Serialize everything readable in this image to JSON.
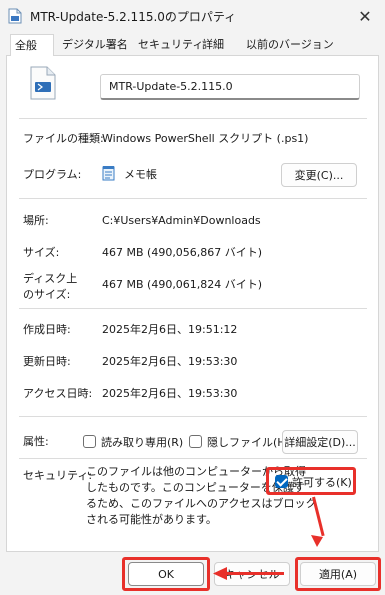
{
  "window": {
    "title": "MTR-Update-5.2.115.0のプロパティ",
    "close_glyph": "✕"
  },
  "tabs": [
    {
      "label": "全般",
      "active": true
    },
    {
      "label": "デジタル署名",
      "active": false
    },
    {
      "label": "セキュリティ",
      "active": false
    },
    {
      "label": "詳細",
      "active": false
    },
    {
      "label": "以前のバージョン",
      "active": false
    }
  ],
  "general": {
    "file_name": "MTR-Update-5.2.115.0",
    "file_type_label": "ファイルの種類:",
    "file_type_value": "Windows PowerShell スクリプト (.ps1)",
    "program_label": "プログラム:",
    "program_value": "メモ帳",
    "change_button": "変更(C)...",
    "location_label": "場所:",
    "location_value": "C:¥Users¥Admin¥Downloads",
    "size_label": "サイズ:",
    "size_value": "467 MB (490,056,867 バイト)",
    "disk_size_label_1": "ディスク上",
    "disk_size_label_2": "のサイズ:",
    "disk_size_value": "467 MB (490,061,824 バイト)",
    "created_label": "作成日時:",
    "created_value": "2025年2月6日、19:51:12",
    "modified_label": "更新日時:",
    "modified_value": "2025年2月6日、19:53:30",
    "accessed_label": "アクセス日時:",
    "accessed_value": "2025年2月6日、19:53:30",
    "attributes_label": "属性:",
    "readonly_label": "読み取り専用(R)",
    "readonly_checked": false,
    "hidden_label": "隠しファイル(H)",
    "hidden_checked": false,
    "advanced_button": "詳細設定(D)...",
    "security_label": "セキュリティ:",
    "security_text": [
      "このファイルは他のコンピューターから取得",
      "したものです。このコンピューターを保護す",
      "るため、このファイルへのアクセスはブロック",
      "される可能性があります。"
    ],
    "allow_label": "許可する(K)",
    "allow_checked": true
  },
  "footer": {
    "ok_button": "OK",
    "cancel_button": "キャンセル",
    "apply_button": "適用(A)"
  },
  "colors": {
    "highlight": "#e8302a",
    "accent": "#0067c0"
  }
}
